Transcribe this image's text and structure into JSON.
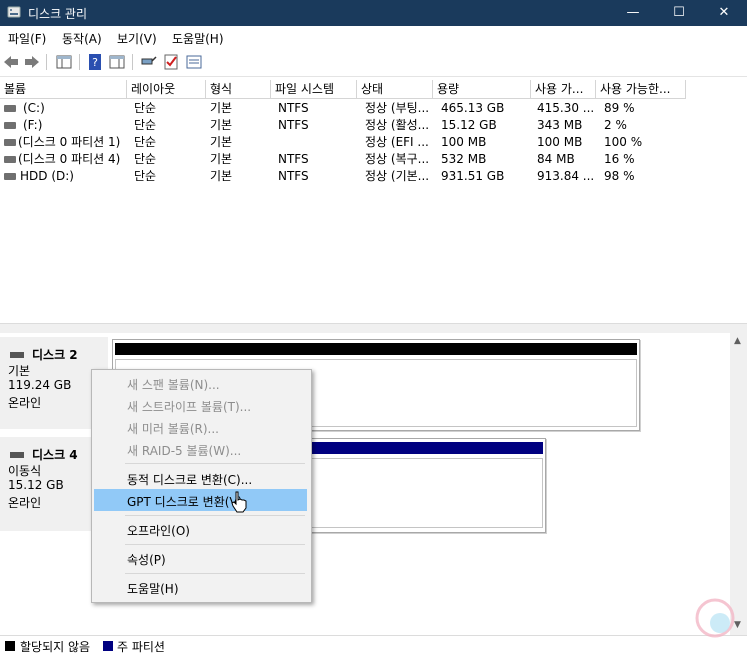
{
  "window": {
    "title": "디스크 관리",
    "minimize": "—",
    "maximize": "☐",
    "close": "✕"
  },
  "menu": [
    "파일(F)",
    "동작(A)",
    "보기(V)",
    "도움말(H)"
  ],
  "columns": [
    "볼륨",
    "레이아웃",
    "형식",
    "파일 시스템",
    "상태",
    "용량",
    "사용 가...",
    "사용 가능한..."
  ],
  "volumes": [
    {
      "name": "(C:)",
      "layout": "단순",
      "type": "기본",
      "fs": "NTFS",
      "status": "정상 (부팅...",
      "capacity": "465.13 GB",
      "free": "415.30 ...",
      "pct": "89 %"
    },
    {
      "name": "(F:)",
      "layout": "단순",
      "type": "기본",
      "fs": "NTFS",
      "status": "정상 (활성...",
      "capacity": "15.12 GB",
      "free": "343 MB",
      "pct": "2 %"
    },
    {
      "name": "(디스크 0 파티션 1)",
      "layout": "단순",
      "type": "기본",
      "fs": "",
      "status": "정상 (EFI ...",
      "capacity": "100 MB",
      "free": "100 MB",
      "pct": "100 %"
    },
    {
      "name": "(디스크 0 파티션 4)",
      "layout": "단순",
      "type": "기본",
      "fs": "NTFS",
      "status": "정상 (복구...",
      "capacity": "532 MB",
      "free": "84 MB",
      "pct": "16 %"
    },
    {
      "name": "HDD (D:)",
      "layout": "단순",
      "type": "기본",
      "fs": "NTFS",
      "status": "정상 (기본...",
      "capacity": "931.51 GB",
      "free": "913.84 ...",
      "pct": "98 %"
    }
  ],
  "disks": [
    {
      "name": "디스크 2",
      "kind": "기본",
      "size": "119.24 GB",
      "state": "온라인"
    },
    {
      "name": "디스크 4",
      "kind": "이동식",
      "size": "15.12 GB",
      "state": "온라인"
    }
  ],
  "context_menu": [
    {
      "label": "새 스팬 볼륨(N)...",
      "enabled": false
    },
    {
      "label": "새 스트라이프 볼륨(T)...",
      "enabled": false
    },
    {
      "label": "새 미러 볼륨(R)...",
      "enabled": false
    },
    {
      "label": "새 RAID-5 볼륨(W)...",
      "enabled": false
    },
    {
      "label": "동적 디스크로 변환(C)...",
      "enabled": true
    },
    {
      "label": "GPT 디스크로 변환(V)",
      "enabled": true,
      "highlighted": true
    },
    {
      "label": "오프라인(O)",
      "enabled": true
    },
    {
      "label": "속성(P)",
      "enabled": true
    },
    {
      "label": "도움말(H)",
      "enabled": true
    }
  ],
  "legend": [
    {
      "label": "할당되지 않음",
      "color": "#000000"
    },
    {
      "label": "주 파티션",
      "color": "#000080"
    }
  ],
  "colors": {
    "titlebar": "#1a3a5c",
    "highlight": "#91c9f7",
    "primary_partition": "#000080",
    "unallocated": "#000000"
  }
}
